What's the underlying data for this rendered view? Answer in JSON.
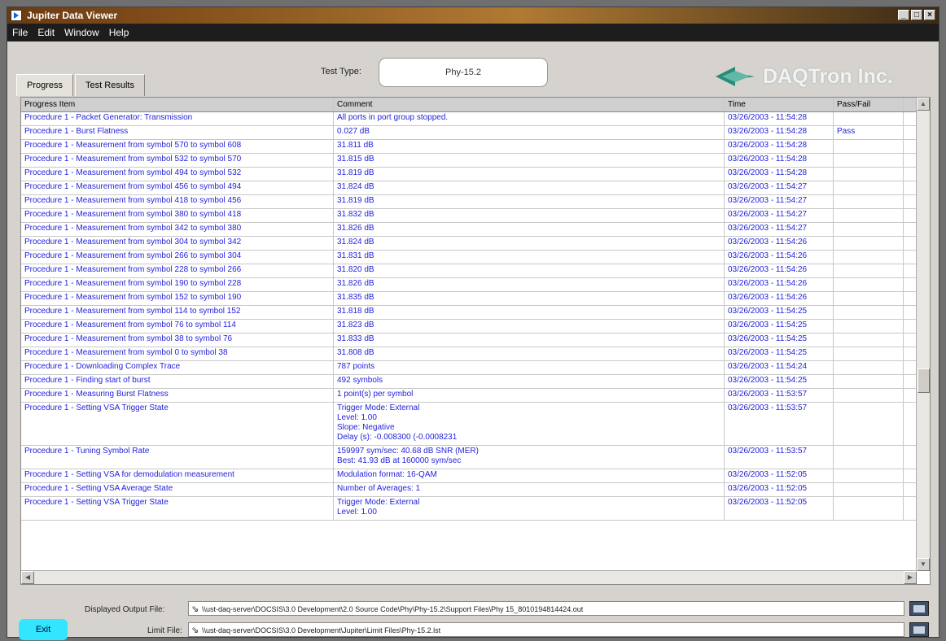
{
  "window": {
    "title": "Jupiter Data Viewer",
    "buttons": [
      "_",
      "□",
      "×"
    ]
  },
  "menu": [
    "File",
    "Edit",
    "Window",
    "Help"
  ],
  "tabs": [
    {
      "label": "Progress",
      "active": true
    },
    {
      "label": "Test Results",
      "active": false
    }
  ],
  "test_type": {
    "label": "Test Type:",
    "value": "Phy-15.2"
  },
  "logo": {
    "text": "DAQTron Inc."
  },
  "table": {
    "headers": [
      "Progress Item",
      "Comment",
      "Time",
      "Pass/Fail"
    ],
    "rows": [
      {
        "item": "Procedure 1 - Packet Generator: Transmission",
        "comment": [
          "All ports in port group stopped."
        ],
        "time": "03/26/2003 - 11:54:28",
        "status": ""
      },
      {
        "item": "Procedure 1 - Burst Flatness",
        "comment": [
          "0.027 dB"
        ],
        "time": "03/26/2003 - 11:54:28",
        "status": "Pass"
      },
      {
        "item": "Procedure 1 - Measurement from symbol 570 to symbol 608",
        "comment": [
          "31.811 dB"
        ],
        "time": "03/26/2003 - 11:54:28",
        "status": ""
      },
      {
        "item": "Procedure 1 - Measurement from symbol 532 to symbol 570",
        "comment": [
          "31.815 dB"
        ],
        "time": "03/26/2003 - 11:54:28",
        "status": ""
      },
      {
        "item": "Procedure 1 - Measurement from symbol 494 to symbol 532",
        "comment": [
          "31.819 dB"
        ],
        "time": "03/26/2003 - 11:54:28",
        "status": ""
      },
      {
        "item": "Procedure 1 - Measurement from symbol 456 to symbol 494",
        "comment": [
          "31.824 dB"
        ],
        "time": "03/26/2003 - 11:54:27",
        "status": ""
      },
      {
        "item": "Procedure 1 - Measurement from symbol 418 to symbol 456",
        "comment": [
          "31.819 dB"
        ],
        "time": "03/26/2003 - 11:54:27",
        "status": ""
      },
      {
        "item": "Procedure 1 - Measurement from symbol 380 to symbol 418",
        "comment": [
          "31.832 dB"
        ],
        "time": "03/26/2003 - 11:54:27",
        "status": ""
      },
      {
        "item": "Procedure 1 - Measurement from symbol 342 to symbol 380",
        "comment": [
          "31.826 dB"
        ],
        "time": "03/26/2003 - 11:54:27",
        "status": ""
      },
      {
        "item": "Procedure 1 - Measurement from symbol 304 to symbol 342",
        "comment": [
          "31.824 dB"
        ],
        "time": "03/26/2003 - 11:54:26",
        "status": ""
      },
      {
        "item": "Procedure 1 - Measurement from symbol 266 to symbol 304",
        "comment": [
          "31.831 dB"
        ],
        "time": "03/26/2003 - 11:54:26",
        "status": ""
      },
      {
        "item": "Procedure 1 - Measurement from symbol 228 to symbol 266",
        "comment": [
          "31.820 dB"
        ],
        "time": "03/26/2003 - 11:54:26",
        "status": ""
      },
      {
        "item": "Procedure 1 - Measurement from symbol 190 to symbol 228",
        "comment": [
          "31.826 dB"
        ],
        "time": "03/26/2003 - 11:54:26",
        "status": ""
      },
      {
        "item": "Procedure 1 - Measurement from symbol 152 to symbol 190",
        "comment": [
          "31.835 dB"
        ],
        "time": "03/26/2003 - 11:54:26",
        "status": ""
      },
      {
        "item": "Procedure 1 - Measurement from symbol 114 to symbol 152",
        "comment": [
          "31.818 dB"
        ],
        "time": "03/26/2003 - 11:54:25",
        "status": ""
      },
      {
        "item": "Procedure 1 - Measurement from symbol 76 to symbol 114",
        "comment": [
          "31.823 dB"
        ],
        "time": "03/26/2003 - 11:54:25",
        "status": ""
      },
      {
        "item": "Procedure 1 - Measurement from symbol 38 to symbol 76",
        "comment": [
          "31.833 dB"
        ],
        "time": "03/26/2003 - 11:54:25",
        "status": ""
      },
      {
        "item": "Procedure 1 - Measurement from symbol 0 to symbol 38",
        "comment": [
          "31.808 dB"
        ],
        "time": "03/26/2003 - 11:54:25",
        "status": ""
      },
      {
        "item": "Procedure 1 - Downloading Complex Trace",
        "comment": [
          "787 points"
        ],
        "time": "03/26/2003 - 11:54:24",
        "status": ""
      },
      {
        "item": "Procedure 1 - Finding start of burst",
        "comment": [
          "492 symbols"
        ],
        "time": "03/26/2003 - 11:54:25",
        "status": ""
      },
      {
        "item": "Procedure 1 - Measuring Burst Flatness",
        "comment": [
          "1 point(s) per symbol"
        ],
        "time": "03/26/2003 - 11:53:57",
        "status": ""
      },
      {
        "item": "Procedure 1 - Setting VSA Trigger State",
        "comment": [
          "Trigger Mode: External",
          "Level: 1.00",
          "Slope: Negative",
          "Delay (s): -0.008300 (-0.0008231"
        ],
        "time": "03/26/2003 - 11:53:57",
        "status": ""
      },
      {
        "item": "Procedure 1 - Tuning Symbol Rate",
        "comment": [
          "159997 sym/sec: 40.68 dB SNR (MER)",
          "Best: 41.93 dB at 160000 sym/sec"
        ],
        "time": "03/26/2003 - 11:53:57",
        "status": ""
      },
      {
        "item": "Procedure 1 - Setting VSA for demodulation measurement",
        "comment": [
          "Modulation format: 16-QAM"
        ],
        "time": "03/26/2003 - 11:52:05",
        "status": ""
      },
      {
        "item": "Procedure 1 - Setting VSA Average State",
        "comment": [
          "Number of Averages: 1"
        ],
        "time": "03/26/2003 - 11:52:05",
        "status": ""
      },
      {
        "item": "Procedure 1 - Setting VSA Trigger State",
        "comment": [
          "Trigger Mode: External",
          "Level: 1.00"
        ],
        "time": "03/26/2003 - 11:52:05",
        "status": ""
      }
    ]
  },
  "bottom": {
    "exit_label": "Exit",
    "output_file_label": "Displayed Output File:",
    "output_file_value": "\\\\ust-daq-server\\DOCSIS\\3.0 Development\\2.0 Source Code\\Phy\\Phy-15.2\\Support Files\\Phy 15_8010194814424.out",
    "limit_file_label": "Limit File:",
    "limit_file_value": "\\\\ust-daq-server\\DOCSIS\\3.0 Development\\Jupiter\\Limit Files\\Phy-15.2.lst"
  }
}
